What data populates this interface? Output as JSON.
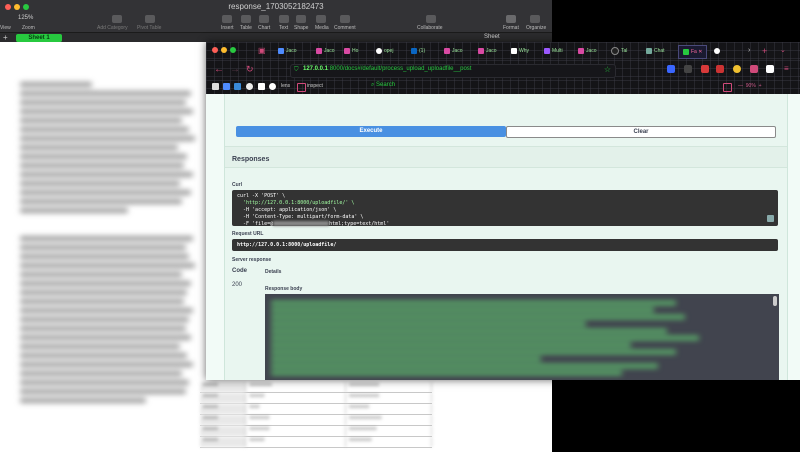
{
  "numbers": {
    "window_title": "response_1703052182473",
    "zoom": "125%",
    "toolbar": {
      "view": "View",
      "zoom": "Zoom",
      "add_category": "Add Category",
      "pivot_table": "Pivot Table",
      "insert": "Insert",
      "table": "Table",
      "chart": "Chart",
      "text": "Text",
      "shape": "Shape",
      "media": "Media",
      "comment": "Comment",
      "collaborate": "Collaborate",
      "format": "Format",
      "organize": "Organize"
    },
    "sheet_tab": "Sheet 1",
    "sheet_label": "Sheet",
    "add_sheet": "+"
  },
  "browser": {
    "tabs": [
      {
        "label": "Jaco",
        "color": "#4f8cff"
      },
      {
        "label": "Jaco",
        "color": "#d94aa3"
      },
      {
        "label": "Ho",
        "color": "#d94aa3"
      },
      {
        "label": "opej",
        "color": "#ffffff"
      },
      {
        "label": "(1)",
        "color": "#0a66c2"
      },
      {
        "label": "Jaco",
        "color": "#d94aa3"
      },
      {
        "label": "Jaco",
        "color": "#d94aa3"
      },
      {
        "label": "Why",
        "color": "#ffffff"
      },
      {
        "label": "Multi",
        "color": "#9b59ff"
      },
      {
        "label": "Jaco",
        "color": "#d94aa3"
      },
      {
        "label": "Tal",
        "color": "#222222"
      },
      {
        "label": "Chat",
        "color": "#74aa9c"
      }
    ],
    "active_tab": "Fa",
    "url_prefix": "127.0.0.1",
    "url_rest": ":8000/docs#/default/process_upload_uploadfile__post",
    "zoom": "90%",
    "bookmarks": {
      "item1": "lens",
      "item2": "inspect",
      "search": "Search"
    }
  },
  "swagger": {
    "execute_label": "Execute",
    "clear_label": "Clear",
    "responses_heading": "Responses",
    "curl_label": "Curl",
    "curl_lines": [
      "curl -X 'POST' \\",
      "  'http://127.0.0.1:8000/uploadfile/' \\",
      "  -H 'accept: application/json' \\",
      "  -H 'Content-Type: multipart/form-data' \\"
    ],
    "curl_last_prefix": "  -F 'file=@",
    "curl_last_suffix": "html;type=text/html'",
    "request_url_label": "Request URL",
    "request_url": "http://127.0.0.1:8000/uploadfile/",
    "server_response_label": "Server response",
    "code_header": "Code",
    "details_header": "Details",
    "code": "200",
    "response_body_label": "Response body"
  },
  "colors": {
    "accent_green": "#27c93f",
    "execute_blue": "#4990e2",
    "pink": "#d04a7a"
  }
}
